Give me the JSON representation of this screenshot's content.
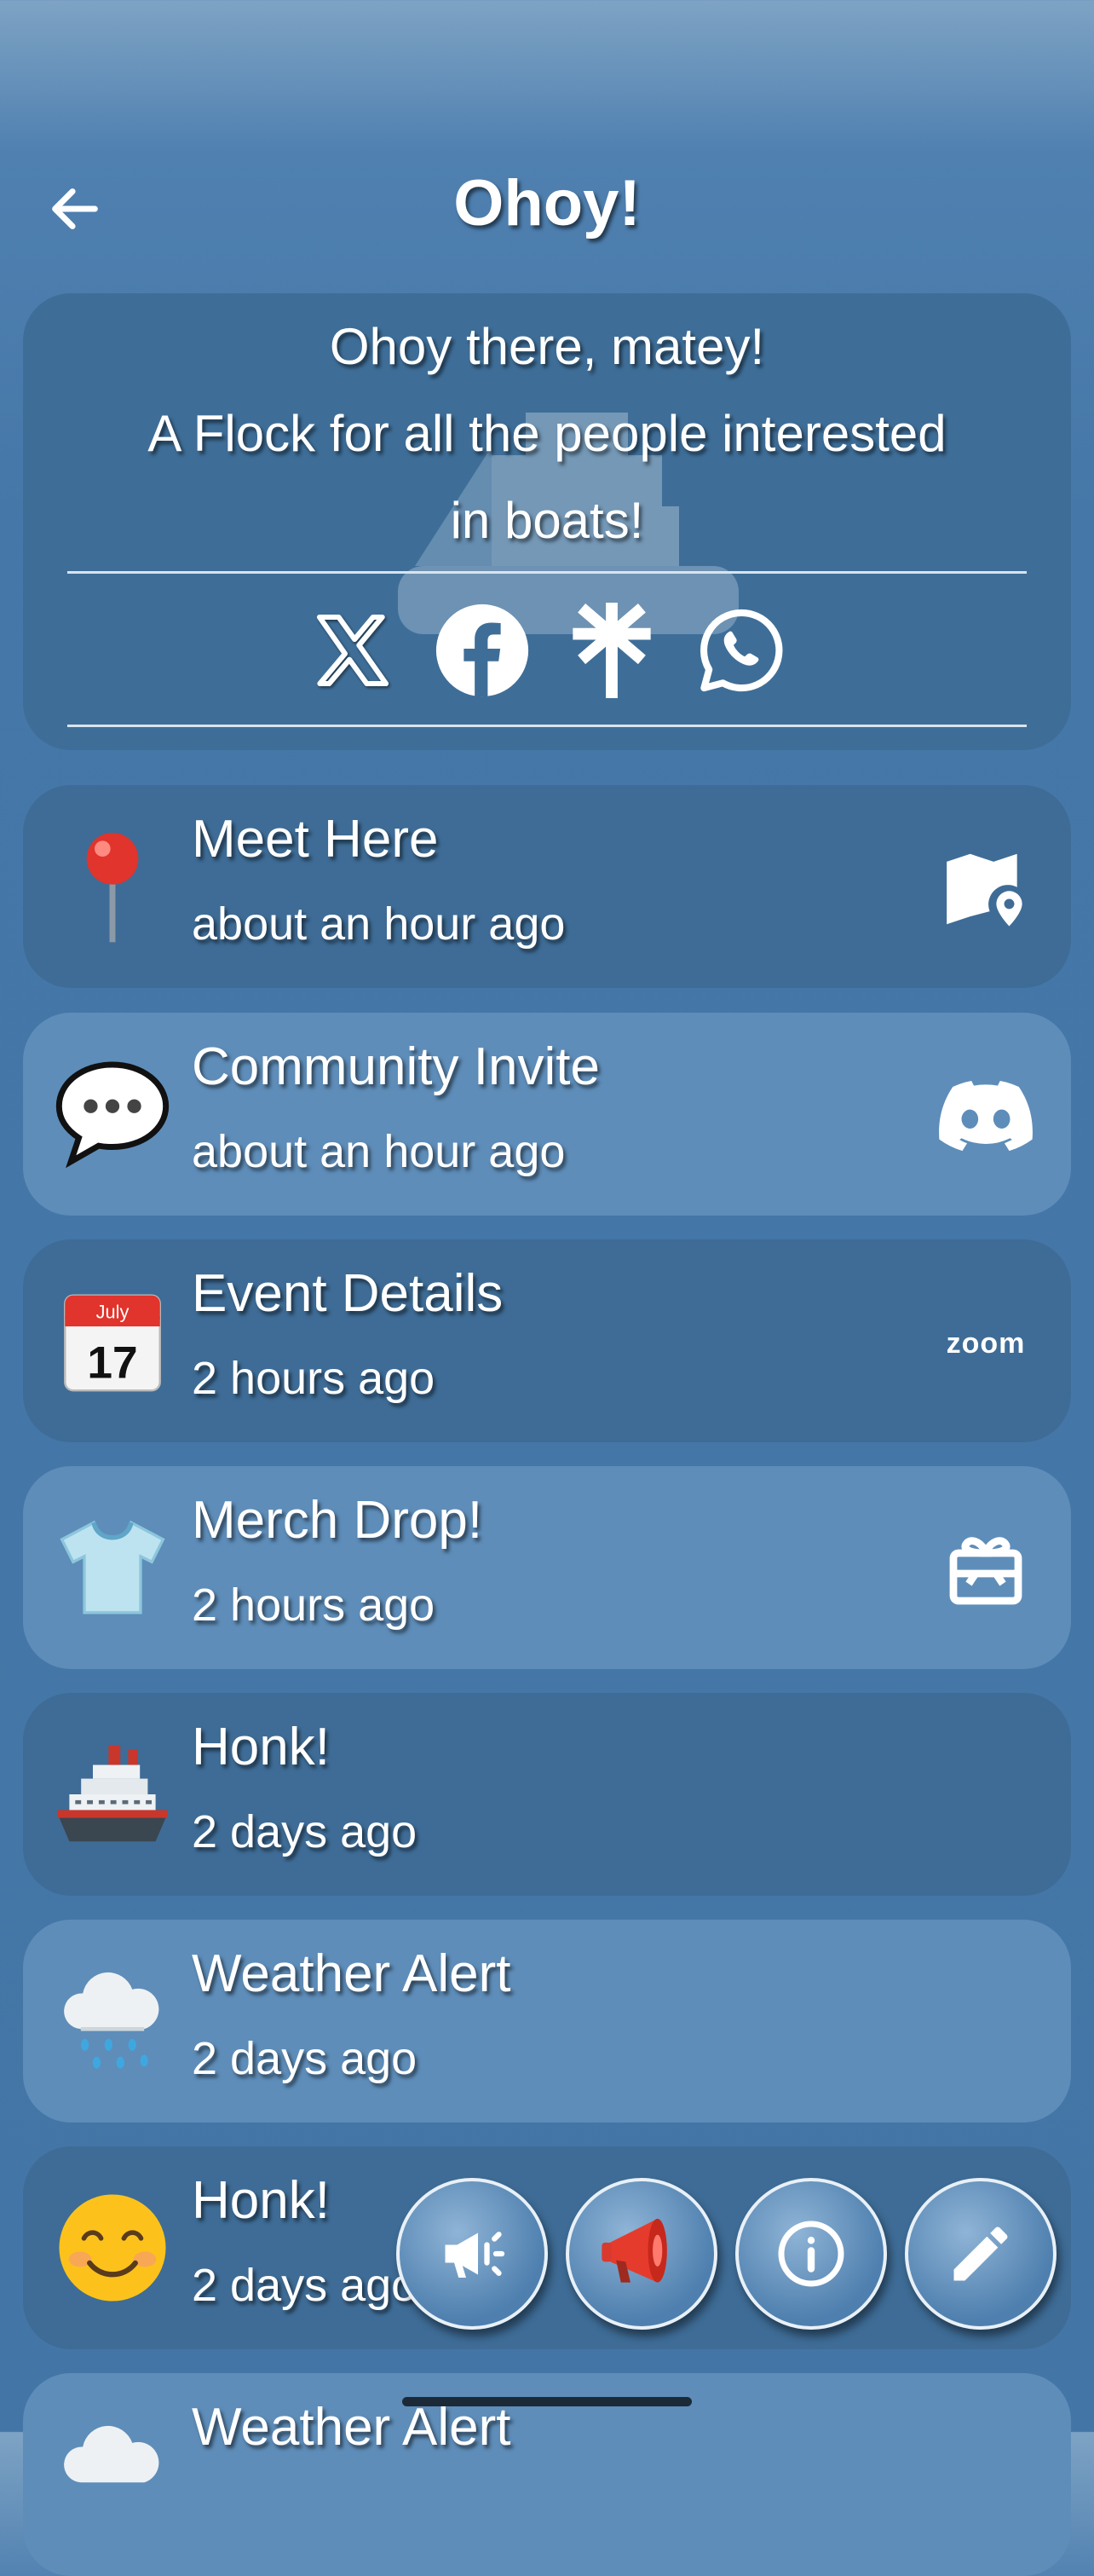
{
  "header": {
    "title": "Ohoy!"
  },
  "intro": {
    "line1": "Ohoy there, matey!",
    "line2": "A Flock for all the people interested",
    "line3": "in boats!"
  },
  "socials": [
    "x-icon",
    "facebook-icon",
    "linktree-icon",
    "whatsapp-icon"
  ],
  "feed": [
    {
      "title": "Meet Here",
      "time": "about an hour ago",
      "emoji": "📍",
      "action": "map-pin-icon"
    },
    {
      "title": "Community Invite",
      "time": "about an hour ago",
      "emoji": "💬",
      "action": "discord-icon"
    },
    {
      "title": "Event Details",
      "time": "2 hours ago",
      "emoji": "📅",
      "action": "zoom-logo",
      "action_text": "zoom",
      "calendar": {
        "month": "July",
        "day": "17"
      }
    },
    {
      "title": "Merch Drop!",
      "time": "2 hours ago",
      "emoji": "👕",
      "action": "gift-card-icon"
    },
    {
      "title": "Honk!",
      "time": "2 days ago",
      "emoji": "🛳️",
      "action": ""
    },
    {
      "title": "Weather Alert",
      "time": "2 days ago",
      "emoji": "🌧️",
      "action": ""
    },
    {
      "title": "Honk!",
      "time": "2 days ago",
      "emoji": "😊",
      "action": ""
    },
    {
      "title": "Weather Alert",
      "time": "",
      "emoji": "🌧️",
      "action": ""
    }
  ],
  "fabs": [
    "megaphone-outline-icon",
    "megaphone-icon",
    "info-icon",
    "edit-icon"
  ],
  "colors": {
    "card_dark": "#3e6c96",
    "card_light": "#5e8db9",
    "background": "#4577a8"
  }
}
